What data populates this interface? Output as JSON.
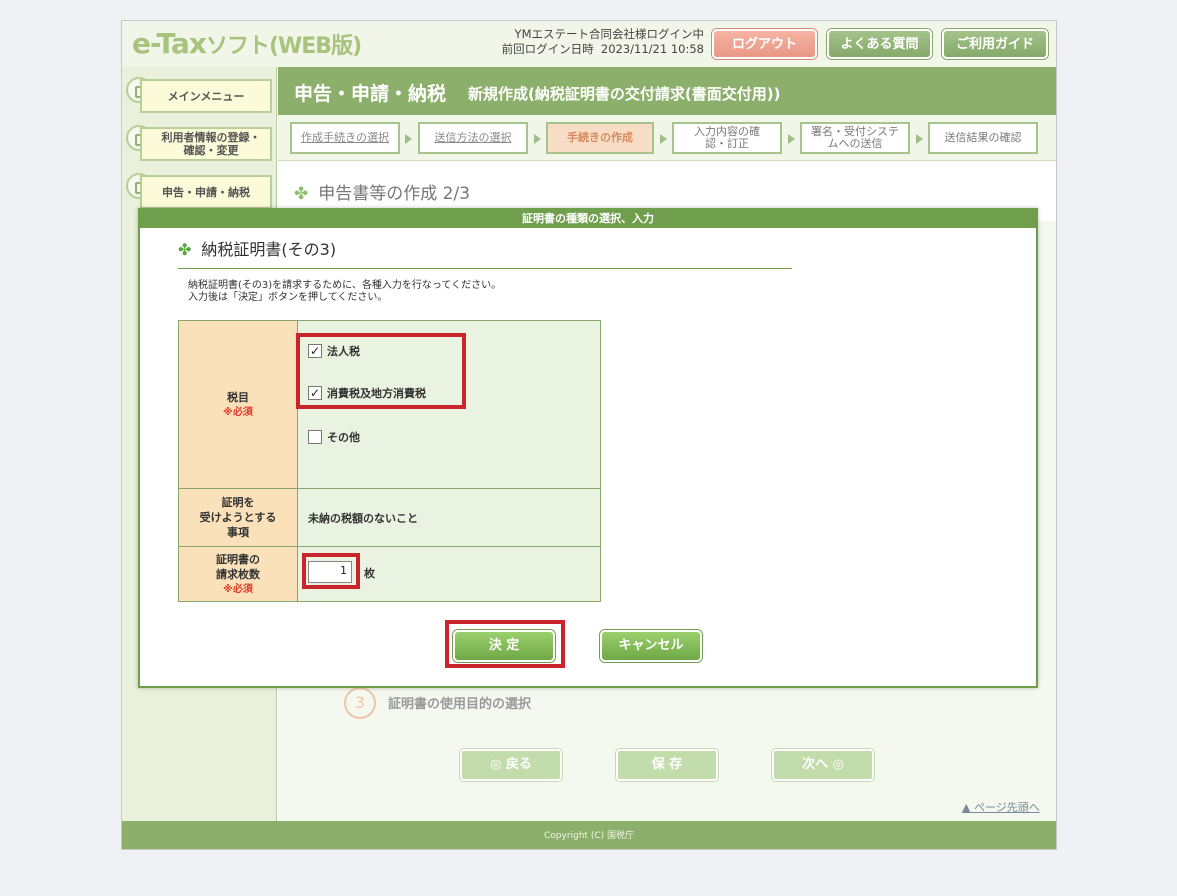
{
  "header": {
    "logo_main": "e-Tax",
    "logo_sub": "ソフト(WEB版)",
    "user_line": "YMエステート合同会社様ログイン中",
    "last_login_label": "前回ログイン日時",
    "last_login_value": "2023/11/21 10:58",
    "logout": "ログアウト",
    "faq": "よくある質問",
    "guide": "ご利用ガイド"
  },
  "sidebar": {
    "items": [
      {
        "label": "メインメニュー"
      },
      {
        "label": "利用者情報の登録・確認・変更"
      },
      {
        "label": "申告・申請・納税"
      }
    ]
  },
  "titlebar": {
    "section": "申告・申請・納税",
    "page": "新規作成(納税証明書の交付請求(書面交付用))"
  },
  "steps": [
    {
      "label": "作成手続きの選択"
    },
    {
      "label": "送信方法の選択"
    },
    {
      "label": "手続きの作成"
    },
    {
      "label": "入力内容の確認・訂正"
    },
    {
      "label": "署名・受付システムへの送信"
    },
    {
      "label": "送信結果の確認"
    }
  ],
  "subtitle": "申告書等の作成 2/3",
  "step3": {
    "number": "3",
    "label": "証明書の使用目的の選択"
  },
  "nav": {
    "back": "◎ 戻る",
    "save": "保 存",
    "next": "次へ ◎"
  },
  "page_top": "ページ先頭へ",
  "footer": "Copyright (C) 国税庁",
  "modal": {
    "header": "証明書の種類の選択、入力",
    "title": "納税証明書(その3)",
    "desc_line1": "納税証明書(その3)を請求するために、各種入力を行なってください。",
    "desc_line2": "入力後は「決定」ボタンを押してください。",
    "rows": {
      "tax": {
        "label": "税目",
        "required": "※必須",
        "options": [
          {
            "label": "法人税",
            "checked": true
          },
          {
            "label": "消費税及地方消費税",
            "checked": true
          },
          {
            "label": "その他",
            "checked": false
          }
        ]
      },
      "matter": {
        "label_l1": "証明を",
        "label_l2": "受けようとする",
        "label_l3": "事項",
        "value": "未納の税額のないこと"
      },
      "count": {
        "label_l1": "証明書の",
        "label_l2": "請求枚数",
        "required": "※必須",
        "value": "1",
        "unit": "枚"
      }
    },
    "confirm": "決 定",
    "cancel": "キャンセル"
  },
  "colors": {
    "brand_green": "#8cb06b",
    "highlight_red": "#c8262b",
    "logout_pink": "#e89884"
  }
}
